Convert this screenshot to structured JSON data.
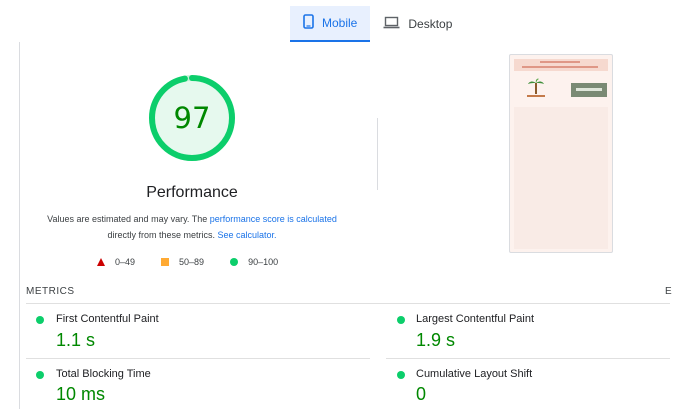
{
  "tabs": [
    {
      "label": "Mobile",
      "icon": "smartphone-icon",
      "active": true
    },
    {
      "label": "Desktop",
      "icon": "laptop-icon",
      "active": false
    }
  ],
  "score": {
    "value": "97",
    "fraction": 0.97,
    "title": "Performance",
    "color": "#0cce6b"
  },
  "description": {
    "text1": "Values are estimated and may vary. The ",
    "link1": "performance score is calculated",
    "text2": "directly from these metrics. ",
    "link2": "See calculator."
  },
  "legend": [
    {
      "label": "0–49",
      "shape": "triangle",
      "color": "#cc0000"
    },
    {
      "label": "50–89",
      "shape": "square",
      "color": "#ffaa33"
    },
    {
      "label": "90–100",
      "shape": "circle",
      "color": "#0cce6b"
    }
  ],
  "metrics": {
    "header": "METRICS",
    "expand_label": "E",
    "items": [
      {
        "name": "First Contentful Paint",
        "value": "1.1 s"
      },
      {
        "name": "Largest Contentful Paint",
        "value": "1.9 s"
      },
      {
        "name": "Total Blocking Time",
        "value": "10 ms"
      },
      {
        "name": "Cumulative Layout Shift",
        "value": "0"
      }
    ]
  }
}
